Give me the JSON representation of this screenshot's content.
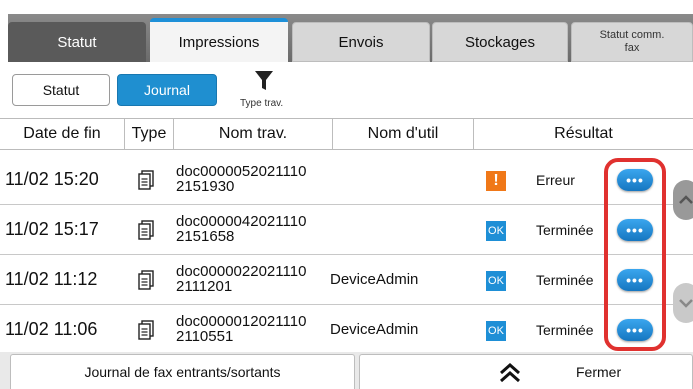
{
  "tabs": {
    "statut": "Statut",
    "impressions": "Impressions",
    "envois": "Envois",
    "stockages": "Stockages",
    "statut_comm_line1": "Statut comm.",
    "statut_comm_line2": "fax",
    "active": "impressions"
  },
  "subbar": {
    "statut_label": "Statut",
    "journal_label": "Journal",
    "filter_label": "Type trav."
  },
  "columns": {
    "date": "Date de fin",
    "type": "Type",
    "name": "Nom trav.",
    "user": "Nom d'util",
    "result": "Résultat"
  },
  "rows": [
    {
      "date": "11/02 15:20",
      "name_line1": "doc0000052021110",
      "name_line2": "2151930",
      "user": "",
      "status_icon": "error-icon",
      "status_mark": "!",
      "result": "Erreur"
    },
    {
      "date": "11/02 15:17",
      "name_line1": "doc0000042021110",
      "name_line2": "2151658",
      "user": "",
      "status_icon": "ok-icon",
      "status_mark": "OK",
      "result": "Terminée"
    },
    {
      "date": "11/02 11:12",
      "name_line1": "doc0000022021110",
      "name_line2": "2111201",
      "user": "DeviceAdmin",
      "status_icon": "ok-icon",
      "status_mark": "OK",
      "result": "Terminée"
    },
    {
      "date": "11/02 11:06",
      "name_line1": "doc0000012021110",
      "name_line2": "2110551",
      "user": "DeviceAdmin",
      "status_icon": "ok-icon",
      "status_mark": "OK",
      "result": "Terminée"
    }
  ],
  "more_label": "•••",
  "footer": {
    "fax_log": "Journal de fax entrants/sortants",
    "close": "Fermer"
  },
  "colors": {
    "accent": "#1f8fd0",
    "error": "#f07818",
    "highlight": "#e0312f"
  }
}
